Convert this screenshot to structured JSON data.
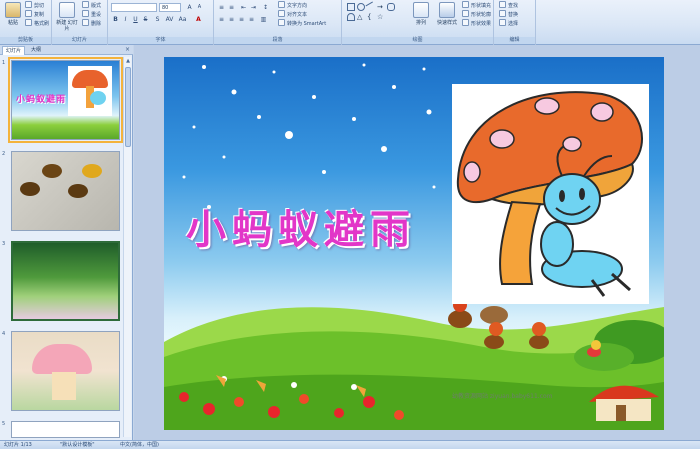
{
  "ribbon": {
    "groups": {
      "clipboard": "剪贴板",
      "slides": "幻灯片",
      "font": "字体",
      "paragraph": "段落",
      "drawing": "绘图",
      "editing": "编辑"
    },
    "clipboard": {
      "paste": "粘贴",
      "cut": "剪切",
      "copy": "复制",
      "format_painter": "格式刷"
    },
    "slides": {
      "new_slide": "新建\n幻灯片",
      "layout": "版式",
      "reset": "重设",
      "delete": "删除"
    },
    "font": {
      "size": "80"
    },
    "paragraph": {
      "text_direction": "文字方向",
      "align_text": "对齐文本",
      "smartart": "转换为 SmartArt"
    },
    "drawing": {
      "arrange": "排列",
      "quick_styles": "快速样式",
      "shape_fill": "形状填充",
      "shape_outline": "形状轮廓",
      "shape_effects": "形状效果"
    },
    "editing": {
      "find": "查找",
      "replace": "替换",
      "select": "选择"
    }
  },
  "leftpanel": {
    "tabs": [
      "幻灯片",
      "大纲"
    ],
    "close_glyph": "×",
    "slide_numbers": [
      "1",
      "2",
      "3",
      "4",
      "5"
    ]
  },
  "slide": {
    "title": "小蚂蚁避雨",
    "credit": "幼教资源网站 ziyuan.baby611.com"
  },
  "statusbar": {
    "slide_info": "幻灯片 1/13",
    "theme": "\"默认设计模板\"",
    "language": "中文(简体，中国)"
  },
  "colors": {
    "title_magenta": "#e236c8",
    "sky_top": "#1a6fc8",
    "grass": "#6cc02a",
    "selection": "#f4b33c"
  },
  "icons": [
    "paste-icon",
    "cut-icon",
    "copy-icon",
    "format-painter-icon",
    "new-slide-icon",
    "bold-icon",
    "italic-icon",
    "underline-icon",
    "arrange-icon",
    "find-icon",
    "replace-icon",
    "select-icon"
  ]
}
